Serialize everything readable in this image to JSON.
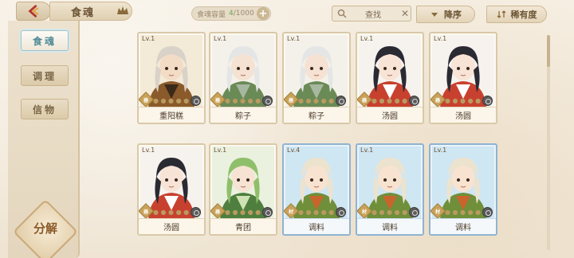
{
  "header": {
    "title": "食魂",
    "capacity_label": "食魂容量",
    "capacity_current": "4",
    "capacity_max": "/1000",
    "search_label": "查找",
    "sort_order_label": "降序",
    "sort_rarity_label": "稀有度"
  },
  "sidebar": {
    "tabs": [
      {
        "label": "食魂",
        "active": true
      },
      {
        "label": "调理",
        "active": false
      },
      {
        "label": "信物",
        "active": false
      }
    ],
    "decompose_label": "分解"
  },
  "cards": [
    {
      "level": "Lv.1",
      "name": "重阳糕",
      "rank": "器",
      "stars": "● ● ● ● ●",
      "style": "plain",
      "theme": "elder"
    },
    {
      "level": "Lv.1",
      "name": "粽子",
      "rank": "器",
      "stars": "● ● ● ● ●",
      "style": "plain",
      "theme": "silver"
    },
    {
      "level": "Lv.1",
      "name": "粽子",
      "rank": "器",
      "stars": "● ● ● ● ●",
      "style": "plain",
      "theme": "silver"
    },
    {
      "level": "Lv.1",
      "name": "汤圆",
      "rank": "器",
      "stars": "● ● ● ● ●",
      "style": "plain",
      "theme": "dark"
    },
    {
      "level": "Lv.1",
      "name": "汤圆",
      "rank": "器",
      "stars": "● ● ● ● ●",
      "style": "plain",
      "theme": "dark"
    },
    {
      "level": "Lv.1",
      "name": "汤圆",
      "rank": "器",
      "stars": "● ● ● ● ●",
      "style": "plain",
      "theme": "dark"
    },
    {
      "level": "Lv.1",
      "name": "青团",
      "rank": "器",
      "stars": "● ● ● ● ●",
      "style": "plain",
      "theme": "green"
    },
    {
      "level": "Lv.4",
      "name": "调料",
      "rank": "材",
      "stars": "● ● ● ● ●",
      "style": "blue",
      "theme": "chibi"
    },
    {
      "level": "Lv.1",
      "name": "调料",
      "rank": "材",
      "stars": "● ● ● ● ●",
      "style": "blue",
      "theme": "chibi"
    },
    {
      "level": "Lv.1",
      "name": "调料",
      "rank": "材",
      "stars": "● ● ● ● ●",
      "style": "blue",
      "theme": "chibi"
    }
  ],
  "colors": {
    "accent": "#4e8a96",
    "panel": "#ede2cf",
    "card_border": "#d9c9a8",
    "card_border_blue": "#8fb3d1"
  }
}
